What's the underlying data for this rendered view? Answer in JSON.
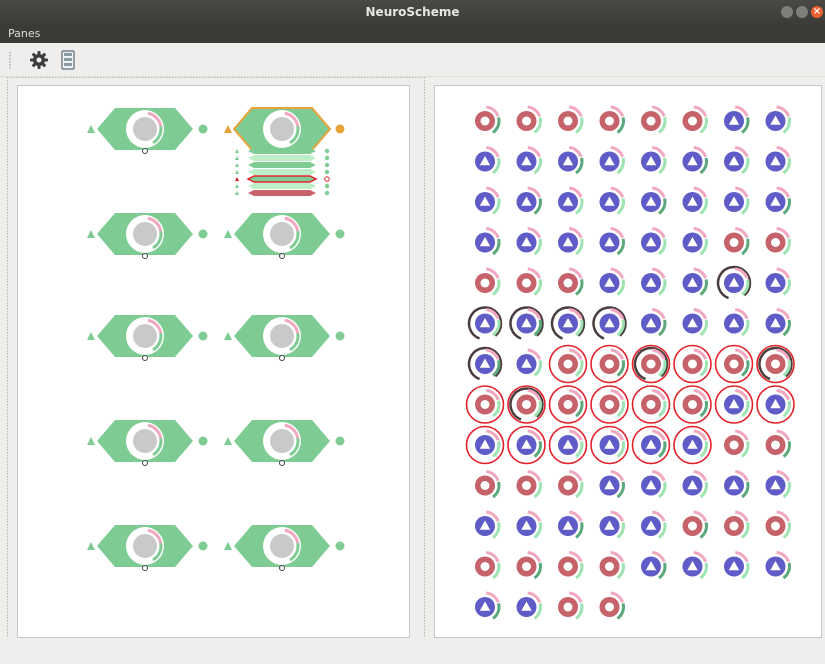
{
  "window": {
    "title": "NeuroScheme",
    "close_glyph": "×"
  },
  "menu": {
    "panes_label": "Panes"
  },
  "toolbar": {
    "icons": [
      "gear-icon",
      "panel-layout-icon"
    ]
  },
  "colors": {
    "title_bg": "#3b3a37",
    "hex_fill": "#7ecc93",
    "hex_selected_border": "#e8a23a",
    "pyramidal_red": "#c6636a",
    "interneuron_blue": "#5f5cc8",
    "circle_core_gray": "#c9c9c9",
    "highlight_red": "#e2232b",
    "dark_ring": "#4a3d3d",
    "pink_arc": "#f2a7c1",
    "light_green_arc": "#9ee3b2",
    "green_arc": "#5aa87c"
  },
  "left_pane": {
    "columns": [
      {
        "items": [
          {
            "selected": false
          },
          {
            "selected": false
          },
          {
            "selected": false
          },
          {
            "selected": false
          },
          {
            "selected": false
          }
        ]
      },
      {
        "items": [
          {
            "selected": true,
            "expanded": true
          },
          {
            "selected": false
          },
          {
            "selected": false
          },
          {
            "selected": false
          },
          {
            "selected": false
          }
        ]
      }
    ]
  },
  "right_pane": {
    "neurons": [
      [
        "R",
        "R",
        "R",
        "R",
        "R",
        "R",
        "B",
        "B"
      ],
      [
        "B",
        "B",
        "B",
        "B",
        "B",
        "B",
        "B",
        "B"
      ],
      [
        "B",
        "B",
        "B",
        "B",
        "B",
        "B",
        "B",
        "B"
      ],
      [
        "B",
        "B",
        "B",
        "B",
        "B",
        "B",
        "R",
        "R"
      ],
      [
        "R",
        "R",
        "R",
        "B",
        "B",
        "B",
        "B",
        "B"
      ],
      [
        "B",
        "B",
        "B",
        "B",
        "B",
        "B",
        "B",
        "B"
      ],
      [
        "B",
        "B",
        "R",
        "R",
        "R",
        "R",
        "R",
        "R"
      ],
      [
        "R",
        "R",
        "R",
        "R",
        "R",
        "R",
        "B",
        "B"
      ],
      [
        "B",
        "B",
        "B",
        "B",
        "B",
        "B",
        "R",
        "R"
      ],
      [
        "R",
        "R",
        "R",
        "B",
        "B",
        "B",
        "B",
        "B"
      ],
      [
        "B",
        "B",
        "B",
        "B",
        "B",
        "R",
        "R",
        "R"
      ],
      [
        "R",
        "R",
        "R",
        "R",
        "B",
        "B",
        "B",
        "B"
      ],
      [
        "B",
        "B",
        "R",
        "R"
      ]
    ],
    "highlighted": [
      [
        6,
        2
      ],
      [
        6,
        3
      ],
      [
        6,
        4
      ],
      [
        6,
        5
      ],
      [
        6,
        6
      ],
      [
        6,
        7
      ],
      [
        7,
        0
      ],
      [
        7,
        1
      ],
      [
        7,
        2
      ],
      [
        7,
        3
      ],
      [
        7,
        4
      ],
      [
        7,
        5
      ],
      [
        7,
        6
      ],
      [
        7,
        7
      ],
      [
        8,
        0
      ],
      [
        8,
        1
      ],
      [
        8,
        2
      ],
      [
        8,
        3
      ],
      [
        8,
        4
      ],
      [
        8,
        5
      ]
    ],
    "dark_ringed": [
      [
        5,
        0
      ],
      [
        5,
        1
      ],
      [
        5,
        2
      ],
      [
        5,
        3
      ],
      [
        4,
        6
      ],
      [
        6,
        0
      ],
      [
        7,
        1
      ],
      [
        6,
        4
      ],
      [
        6,
        7
      ]
    ]
  }
}
